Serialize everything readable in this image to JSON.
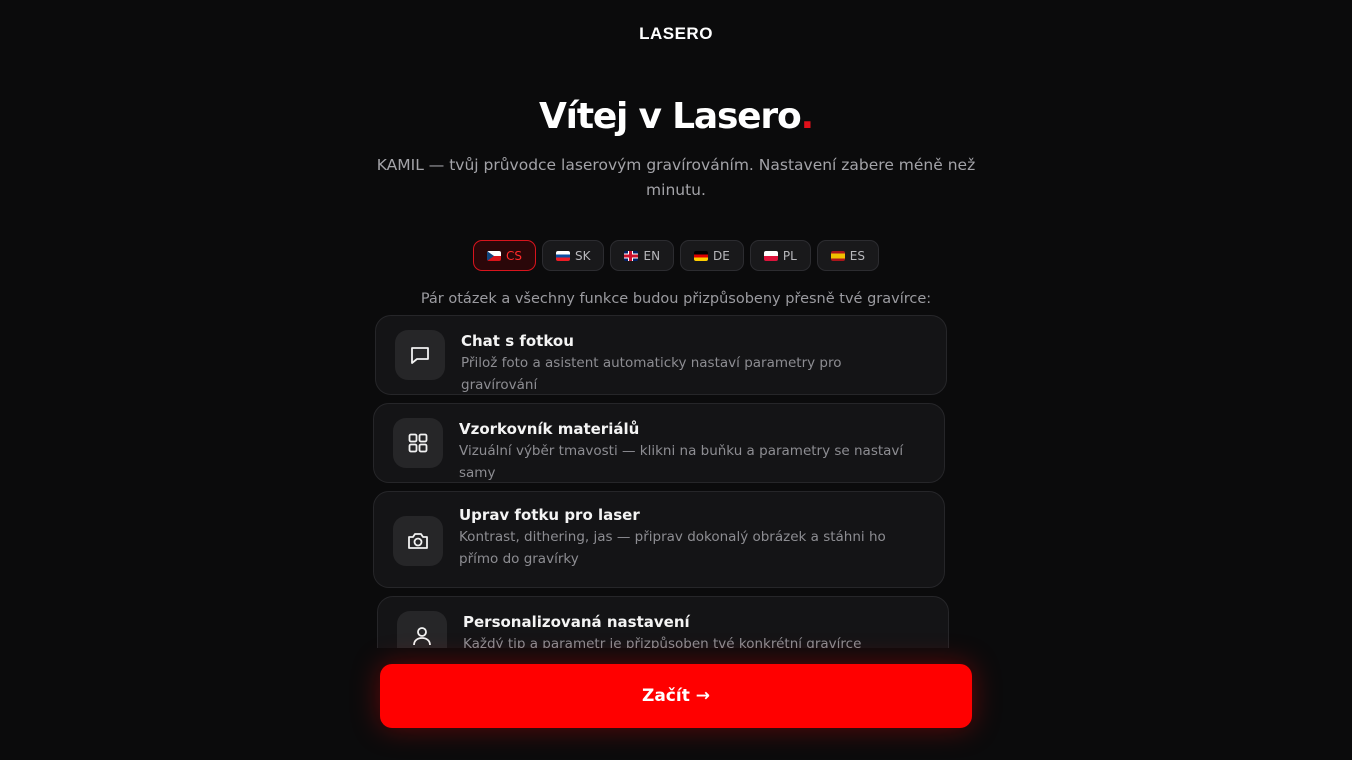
{
  "brand": "LASERO",
  "hero": {
    "title": "Vítej v Lasero",
    "title_dot": ".",
    "subtitle": "KAMIL — tvůj průvodce laserovým gravírováním. Nastavení zabere méně než minutu."
  },
  "languages": [
    {
      "code": "CS",
      "flag": "cz-flag",
      "active": true
    },
    {
      "code": "SK",
      "flag": "sk-flag",
      "active": false
    },
    {
      "code": "EN",
      "flag": "gb-flag",
      "active": false
    },
    {
      "code": "DE",
      "flag": "de-flag",
      "active": false
    },
    {
      "code": "PL",
      "flag": "pl-flag",
      "active": false
    },
    {
      "code": "ES",
      "flag": "es-flag",
      "active": false
    }
  ],
  "intro": "Pár otázek a všechny funkce budou přizpůsobeny přesně tvé gravírce:",
  "features": [
    {
      "icon": "chat-bubble-icon",
      "title": "Chat s fotkou",
      "desc": "Přilož foto a asistent automaticky nastaví parametry pro gravírování"
    },
    {
      "icon": "grid-icon",
      "title": "Vzorkovník materiálů",
      "desc": "Vizuální výběr tmavosti — klikni na buňku a parametry se nastaví samy"
    },
    {
      "icon": "camera-icon",
      "title": "Uprav fotku pro laser",
      "desc": "Kontrast, dithering, jas — připrav dokonalý obrázek a stáhni ho přímo do gravírky"
    },
    {
      "icon": "user-icon",
      "title": "Personalizovaná nastavení",
      "desc": "Každý tip a parametr je přizpůsoben tvé konkrétní gravírce"
    }
  ],
  "cta": {
    "label": "Začít →"
  },
  "colors": {
    "accent": "#ff0000",
    "background": "#0b0b0c",
    "card": "#141416"
  }
}
